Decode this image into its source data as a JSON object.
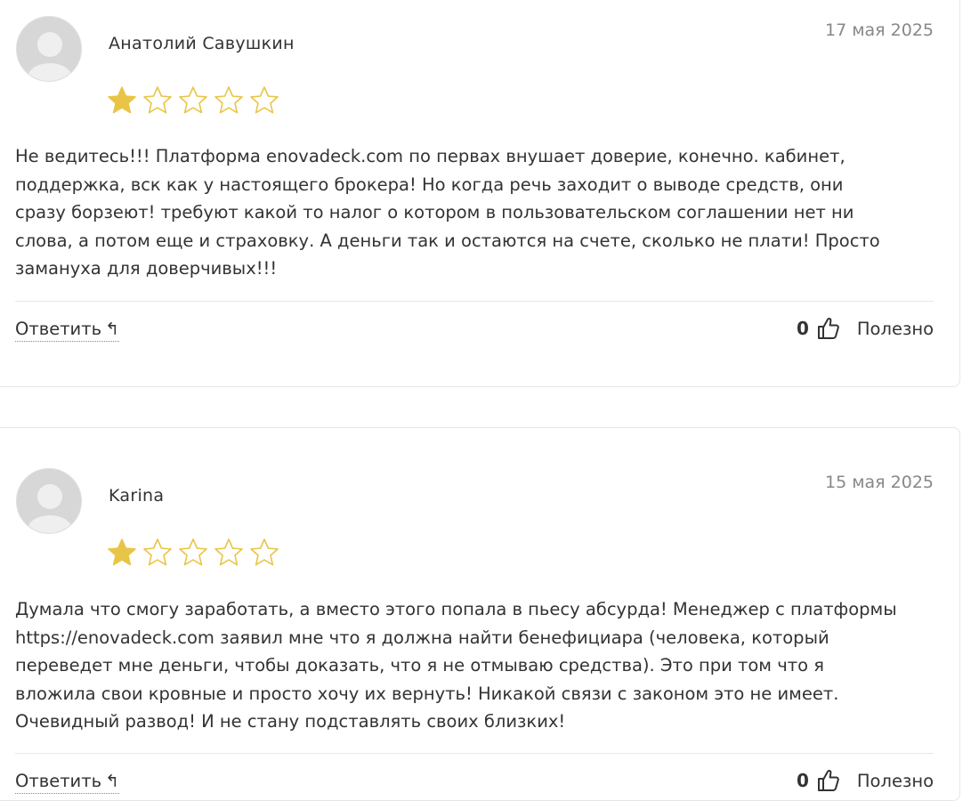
{
  "colors": {
    "star_filled": "#e8c547",
    "star_empty_stroke": "#e8c547",
    "avatar_bg": "#d7d7d7",
    "date_text": "#888888"
  },
  "reviews": [
    {
      "author": "Анатолий Савушкин",
      "date": "17 мая 2025",
      "rating": 1,
      "rating_max": 5,
      "text_lines": [
        "Не ведитесь!!! Платформа enovadeck.com по первах внушает доверие, конечно. кабинет,",
        "поддержка, вск как у настоящего брокера! Но когда речь заходит о выводе средств, они",
        "сразу борзеют! требуют какой то налог о котором в пользовательском соглашении нет ни",
        "слова, а потом еще и страховку. А деньги так и остаются на счете, сколько не плати! Просто",
        "замануха для доверчивых!!!"
      ],
      "reply_label": "Ответить",
      "reply_arrow": "↰",
      "helpful_count": "0",
      "helpful_label": "Полезно"
    },
    {
      "author": "Karina",
      "date": "15 мая 2025",
      "rating": 1,
      "rating_max": 5,
      "text_lines": [
        "Думала что смогу заработать, а вместо этого попала в пьесу абсурда! Менеджер с платформы",
        "https://enovadeck.com заявил мне что я должна найти бенефициара (человека, который",
        "переведет мне деньги, чтобы доказать, что я не отмываю средства). Это при том что я",
        "вложила свои кровные и просто хочу их вернуть! Никакой связи с законом это не имеет.",
        "Очевидный развод! И не стану подставлять своих близких!"
      ],
      "reply_label": "Ответить",
      "reply_arrow": "↰",
      "helpful_count": "0",
      "helpful_label": "Полезно"
    }
  ]
}
